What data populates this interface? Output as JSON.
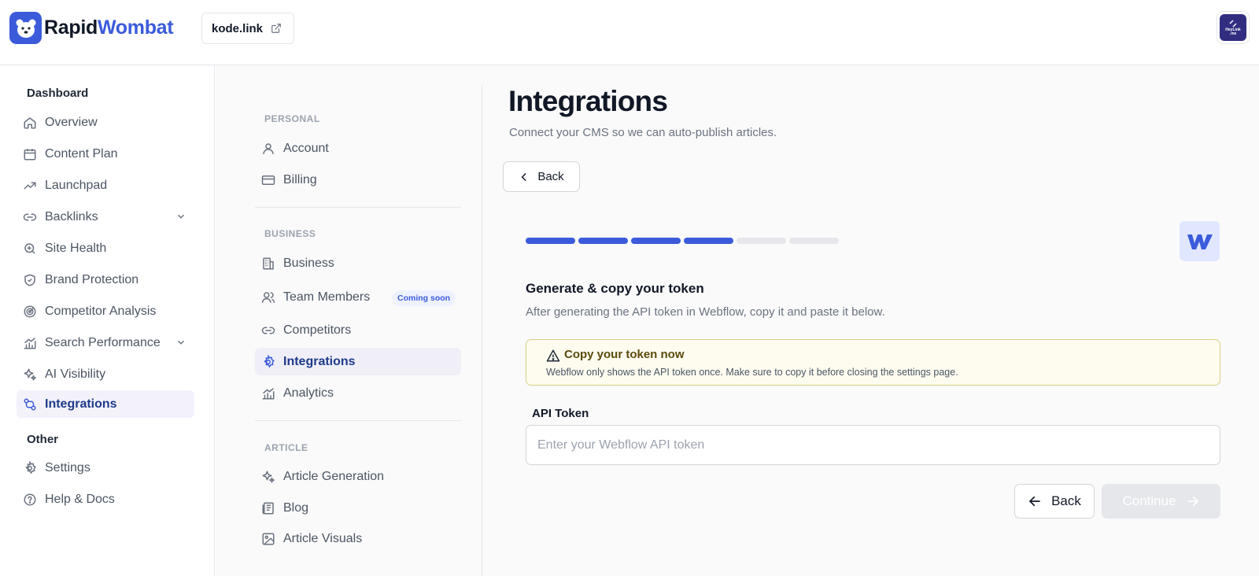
{
  "brand": {
    "name_part1": "Rapid",
    "name_part2": "Wombat"
  },
  "site_chip": {
    "label": "kode.link"
  },
  "avatar": {
    "line1": "HeyLink",
    "line2": ".me"
  },
  "sidebar": {
    "group_dashboard": "Dashboard",
    "items": [
      {
        "label": "Overview",
        "icon": "home-icon"
      },
      {
        "label": "Content Plan",
        "icon": "calendar-icon"
      },
      {
        "label": "Launchpad",
        "icon": "trending-icon"
      },
      {
        "label": "Backlinks",
        "icon": "link-icon"
      },
      {
        "label": "Site Health",
        "icon": "search-icon"
      },
      {
        "label": "Brand Protection",
        "icon": "shield-icon"
      },
      {
        "label": "Competitor Analysis",
        "icon": "radar-icon"
      },
      {
        "label": "Search Performance",
        "icon": "chart-icon"
      },
      {
        "label": "AI Visibility",
        "icon": "sparkles-icon"
      },
      {
        "label": "Integrations",
        "icon": "integrations-icon"
      }
    ],
    "group_other": "Other",
    "other_items": [
      {
        "label": "Settings",
        "icon": "gear-icon"
      },
      {
        "label": "Help & Docs",
        "icon": "help-icon"
      }
    ]
  },
  "settings_nav": {
    "personal_head": "PERSONAL",
    "account": "Account",
    "billing": "Billing",
    "business_head": "BUSINESS",
    "business": "Business",
    "team_members": "Team Members",
    "coming_soon": "Coming soon",
    "competitors": "Competitors",
    "integrations": "Integrations",
    "analytics": "Analytics",
    "article_head": "ARTICLE",
    "article_generation": "Article Generation",
    "blog": "Blog",
    "article_visuals": "Article Visuals"
  },
  "page": {
    "title": "Integrations",
    "subtitle": "Connect your CMS so we can auto-publish articles.",
    "back_label": "Back"
  },
  "wizard": {
    "progress_total": 6,
    "progress_done": 4,
    "step_title": "Generate & copy your token",
    "step_desc": "After generating the API token in Webflow, copy it and paste it below.",
    "warning_title": "Copy your token now",
    "warning_text": "Webflow only shows the API token once. Make sure to copy it before closing the settings page.",
    "field_label": "API Token",
    "field_placeholder": "Enter your Webflow API token",
    "field_value": "",
    "back_label": "Back",
    "continue_label": "Continue"
  },
  "colors": {
    "accent": "#3b5bdb",
    "warning_border": "#d6cf86",
    "warning_bg": "#fdfcef"
  }
}
